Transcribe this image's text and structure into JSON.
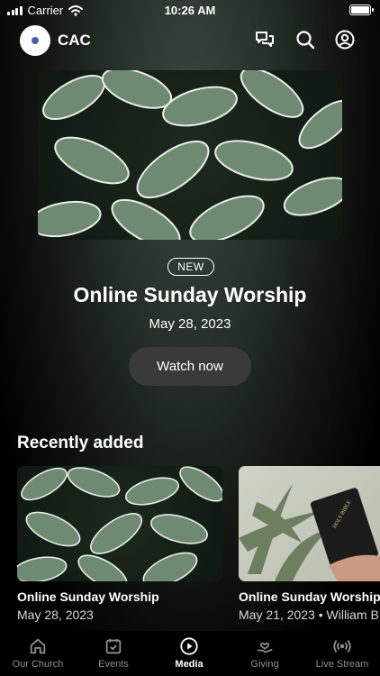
{
  "status_bar": {
    "carrier": "Carrier",
    "time": "10:26 AM"
  },
  "header": {
    "brand": "CAC"
  },
  "hero": {
    "badge": "NEW",
    "title": "Online Sunday Worship",
    "date": "May 28, 2023",
    "button": "Watch now"
  },
  "recently_added": {
    "title": "Recently added",
    "items": [
      {
        "title": "Online Sunday Worship",
        "meta": "May 28, 2023"
      },
      {
        "title": "Online Sunday Worship",
        "meta": "May 21, 2023 • William B"
      }
    ]
  },
  "tabs": [
    {
      "label": "Our Church",
      "icon": "home-icon",
      "active": false
    },
    {
      "label": "Events",
      "icon": "calendar-check-icon",
      "active": false
    },
    {
      "label": "Media",
      "icon": "play-circle-icon",
      "active": true
    },
    {
      "label": "Giving",
      "icon": "hand-heart-icon",
      "active": false
    },
    {
      "label": "Live Stream",
      "icon": "broadcast-icon",
      "active": false
    }
  ],
  "colors": {
    "background": "#000000",
    "button": "#3a3a3a",
    "inactive_tab": "#8e8e8e"
  }
}
